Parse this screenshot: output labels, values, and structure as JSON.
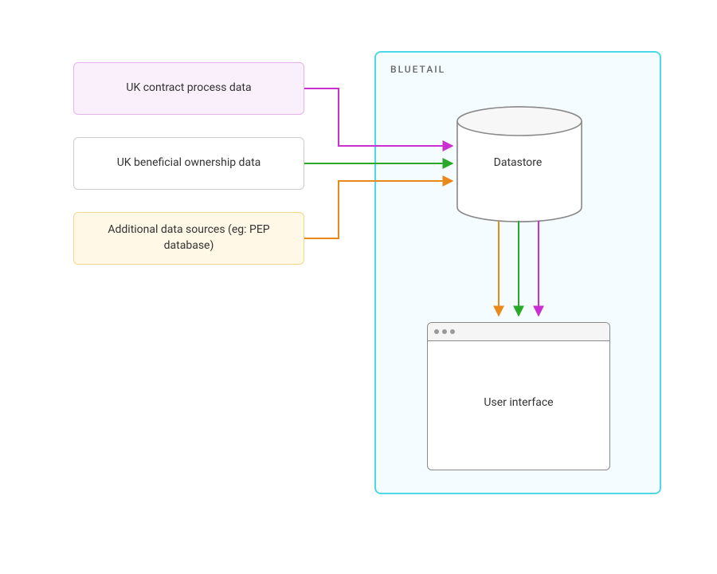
{
  "sources": {
    "contract": "UK contract process data",
    "ownership": "UK beneficial ownership data",
    "additional": "Additional data sources (eg: PEP database)"
  },
  "system": {
    "name": "BLUETAIL",
    "datastore": "Datastore",
    "ui": "User interface"
  },
  "colors": {
    "purple": "#c92fd1",
    "green": "#2aa82a",
    "orange": "#e8891a",
    "cyan": "#4dd8e6",
    "gray": "#888"
  }
}
